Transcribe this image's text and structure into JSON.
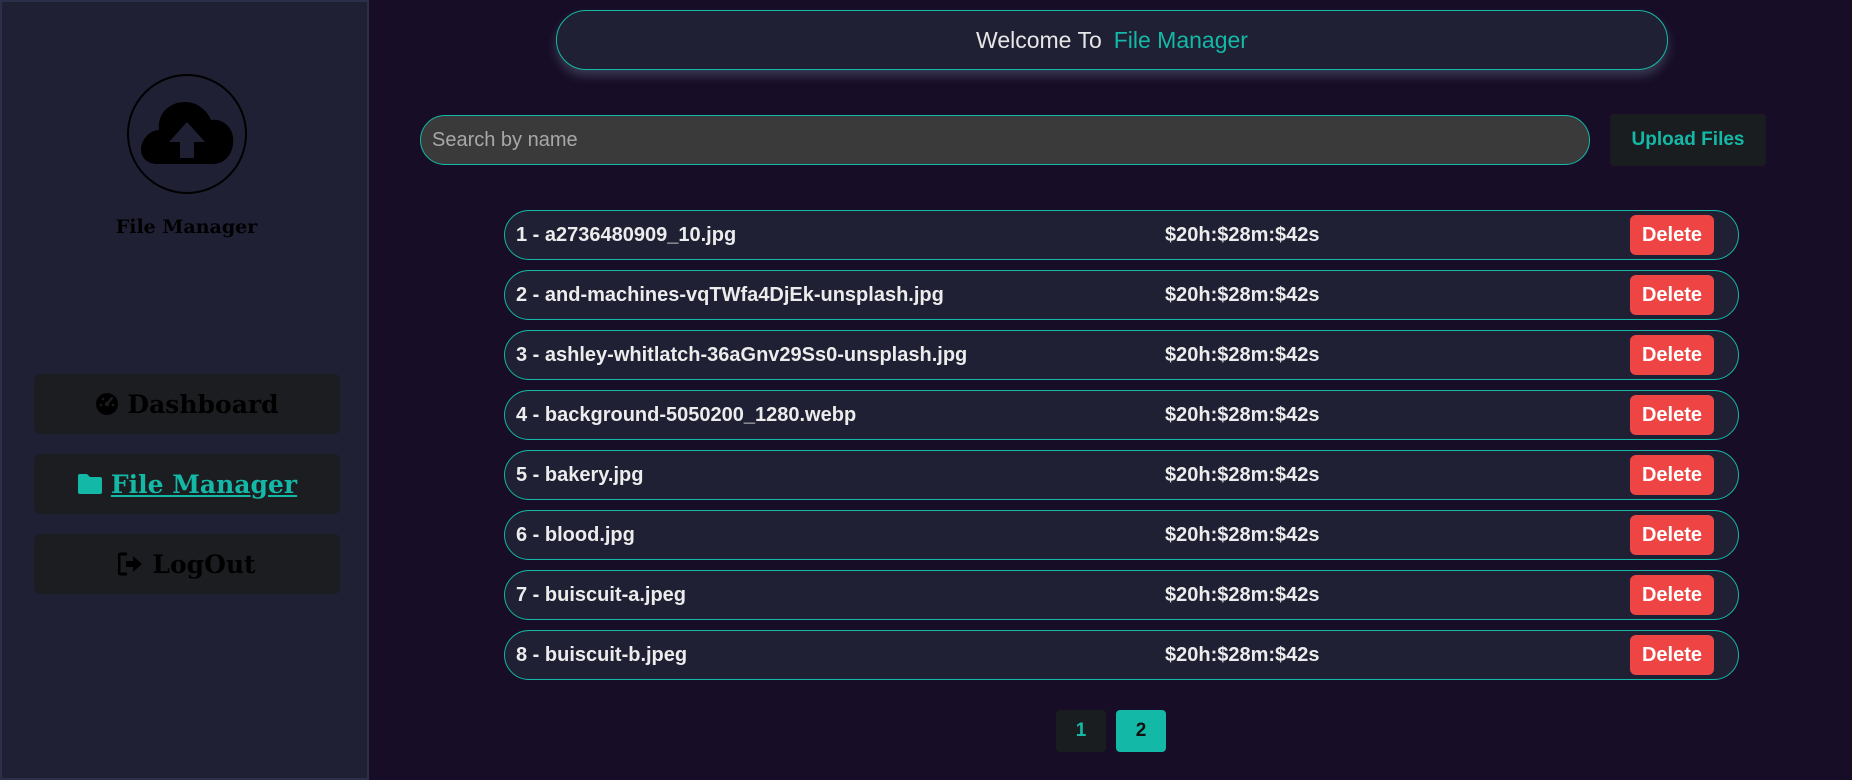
{
  "sidebar": {
    "logo_title": "File Manager",
    "logo_icon": "cloud-upload-icon",
    "nav": [
      {
        "label": "Dashboard",
        "icon": "gauge-icon"
      },
      {
        "label": "File Manager",
        "icon": "folder-icon",
        "active": true
      },
      {
        "label": "LogOut",
        "icon": "logout-icon"
      }
    ]
  },
  "header": {
    "prefix": "Welcome To",
    "accent": "File Manager"
  },
  "search": {
    "placeholder": "Search by name",
    "value": ""
  },
  "toolbar": {
    "upload_label": "Upload Files"
  },
  "files": [
    {
      "name": "1 - a2736480909_10.jpg",
      "time": "$20h:$28m:$42s",
      "delete_label": "Delete"
    },
    {
      "name": "2 - and-machines-vqTWfa4DjEk-unsplash.jpg",
      "time": "$20h:$28m:$42s",
      "delete_label": "Delete"
    },
    {
      "name": "3 - ashley-whitlatch-36aGnv29Ss0-unsplash.jpg",
      "time": "$20h:$28m:$42s",
      "delete_label": "Delete"
    },
    {
      "name": "4 - background-5050200_1280.webp",
      "time": "$20h:$28m:$42s",
      "delete_label": "Delete"
    },
    {
      "name": "5 - bakery.jpg",
      "time": "$20h:$28m:$42s",
      "delete_label": "Delete"
    },
    {
      "name": "6 - blood.jpg",
      "time": "$20h:$28m:$42s",
      "delete_label": "Delete"
    },
    {
      "name": "7 - buiscuit-a.jpeg",
      "time": "$20h:$28m:$42s",
      "delete_label": "Delete"
    },
    {
      "name": "8 - buiscuit-b.jpeg",
      "time": "$20h:$28m:$42s",
      "delete_label": "Delete"
    }
  ],
  "pagination": {
    "pages": [
      "1",
      "2"
    ],
    "current": "2"
  },
  "colors": {
    "accent": "#14b8a6",
    "danger": "#ef4444",
    "background": "#170d27",
    "panel": "#1f2034"
  }
}
